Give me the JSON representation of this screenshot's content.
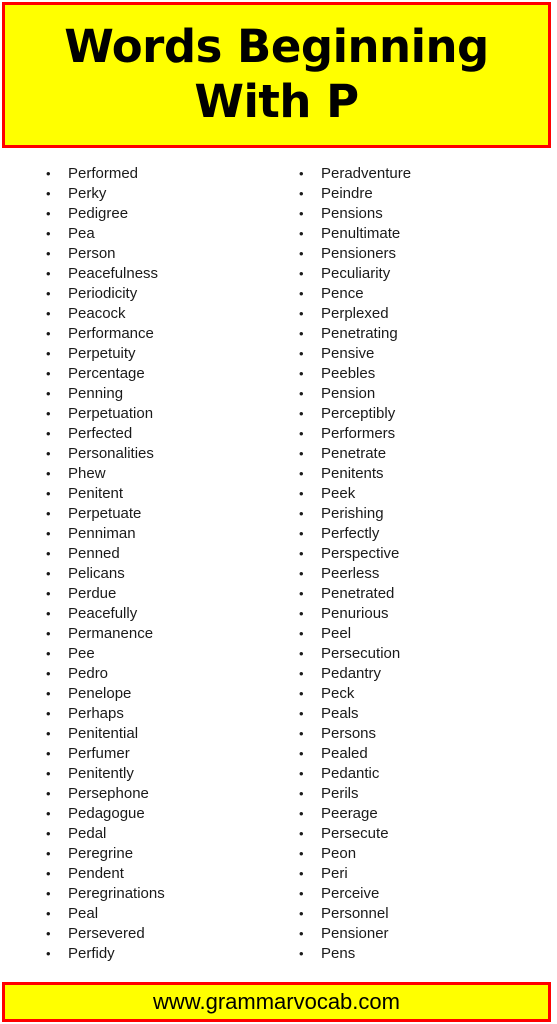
{
  "header": {
    "title": "Words Beginning With P",
    "background_color": "#ffff00",
    "border_color": "#ff0000",
    "text_color": "#000000"
  },
  "footer": {
    "url": "www.grammarvocab.com",
    "background_color": "#ffff00",
    "border_color": "#ff0000",
    "text_color": "#000000"
  },
  "list": {
    "bullet": "•",
    "text_color": "#1a1a1a",
    "columns": [
      {
        "name": "left-column",
        "items": [
          "Performed",
          "Perky",
          "Pedigree",
          "Pea",
          "Person",
          "Peacefulness",
          "Periodicity",
          "Peacock",
          "Performance",
          "Perpetuity",
          "Percentage",
          "Penning",
          "Perpetuation",
          "Perfected",
          "Personalities",
          "Phew",
          "Penitent",
          "Perpetuate",
          "Penniman",
          "Penned",
          "Pelicans",
          "Perdue",
          "Peacefully",
          "Permanence",
          "Pee",
          "Pedro",
          "Penelope",
          "Perhaps",
          "Penitential",
          "Perfumer",
          "Penitently",
          "Persephone",
          "Pedagogue",
          "Pedal",
          "Peregrine",
          "Pendent",
          "Peregrinations",
          "Peal",
          "Persevered",
          "Perfidy"
        ]
      },
      {
        "name": "right-column",
        "items": [
          "Peradventure",
          "Peindre",
          "Pensions",
          "Penultimate",
          "Pensioners",
          "Peculiarity",
          "Pence",
          "Perplexed",
          "Penetrating",
          "Pensive",
          "Peebles",
          "Pension",
          "Perceptibly",
          "Performers",
          "Penetrate",
          "Penitents",
          "Peek",
          "Perishing",
          "Perfectly",
          "Perspective",
          "Peerless",
          "Penetrated",
          "Penurious",
          "Peel",
          "Persecution",
          "Pedantry",
          "Peck",
          "Peals",
          "Persons",
          "Pealed",
          "Pedantic",
          "Perils",
          "Peerage",
          "Persecute",
          "Peon",
          "Peri",
          "Perceive",
          "Personnel",
          "Pensioner",
          "Pens"
        ]
      }
    ]
  }
}
